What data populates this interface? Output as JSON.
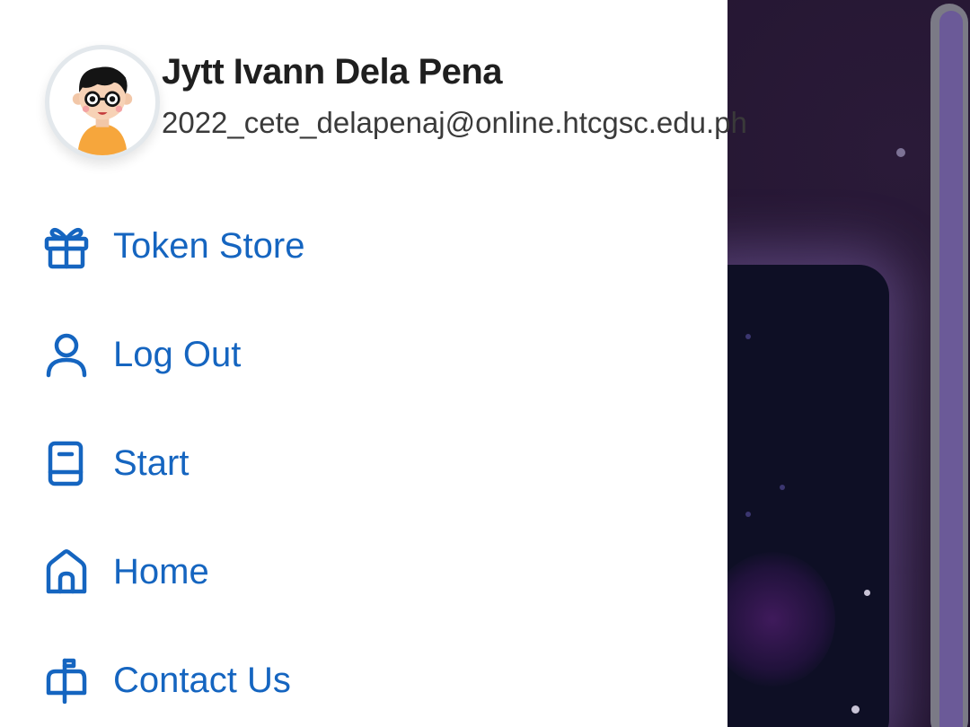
{
  "profile": {
    "name": "Jytt Ivann Dela Pena",
    "email": "2022_cete_delapenaj@online.htcgsc.edu.ph"
  },
  "menu": [
    {
      "label": "Token Store",
      "icon": "gift-icon"
    },
    {
      "label": "Log Out",
      "icon": "user-icon"
    },
    {
      "label": "Start",
      "icon": "book-icon"
    },
    {
      "label": "Home",
      "icon": "home-icon"
    },
    {
      "label": "Contact Us",
      "icon": "mailbox-icon"
    }
  ],
  "colors": {
    "menu_accent": "#1565c0",
    "drawer_bg": "#ffffff",
    "background_app": "#1a1027",
    "scrollbar_thumb": "#6b5a98"
  }
}
